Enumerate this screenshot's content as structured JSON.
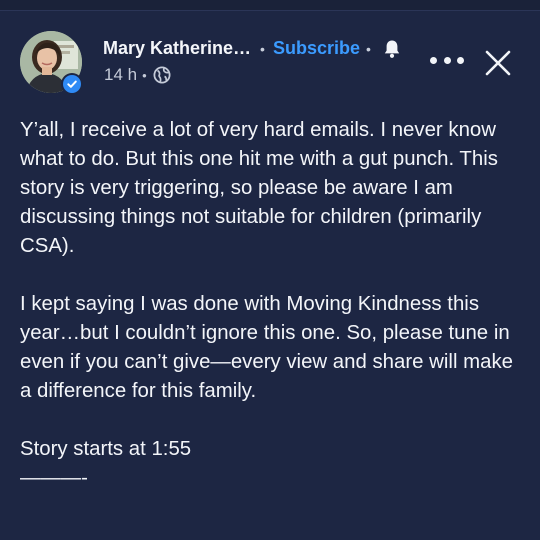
{
  "post": {
    "author_name": "Mary Katherine…",
    "subscribe_label": "Subscribe",
    "time_ago": "14 h",
    "audience_icon": "globe-icon",
    "paragraphs": [
      "Y’all, I receive a lot of very hard emails. I never know what to do. But this one hit me with a gut punch. This story is very triggering, so please be aware I am discussing things not suitable for children (primarily CSA).",
      "I kept saying I was done with Moving Kindness this year…but I couldn’t ignore this one. So, please tune in even if you can’t give—every view and share will make a difference for this family."
    ],
    "story_line": "Story starts at 1:55",
    "divider_line": "———-"
  },
  "colors": {
    "background": "#1d2643",
    "subscribe_accent": "#3b9bff",
    "verified_badge": "#2f8af5",
    "text_primary": "#f3f5f9",
    "text_secondary": "#c4cad8"
  }
}
